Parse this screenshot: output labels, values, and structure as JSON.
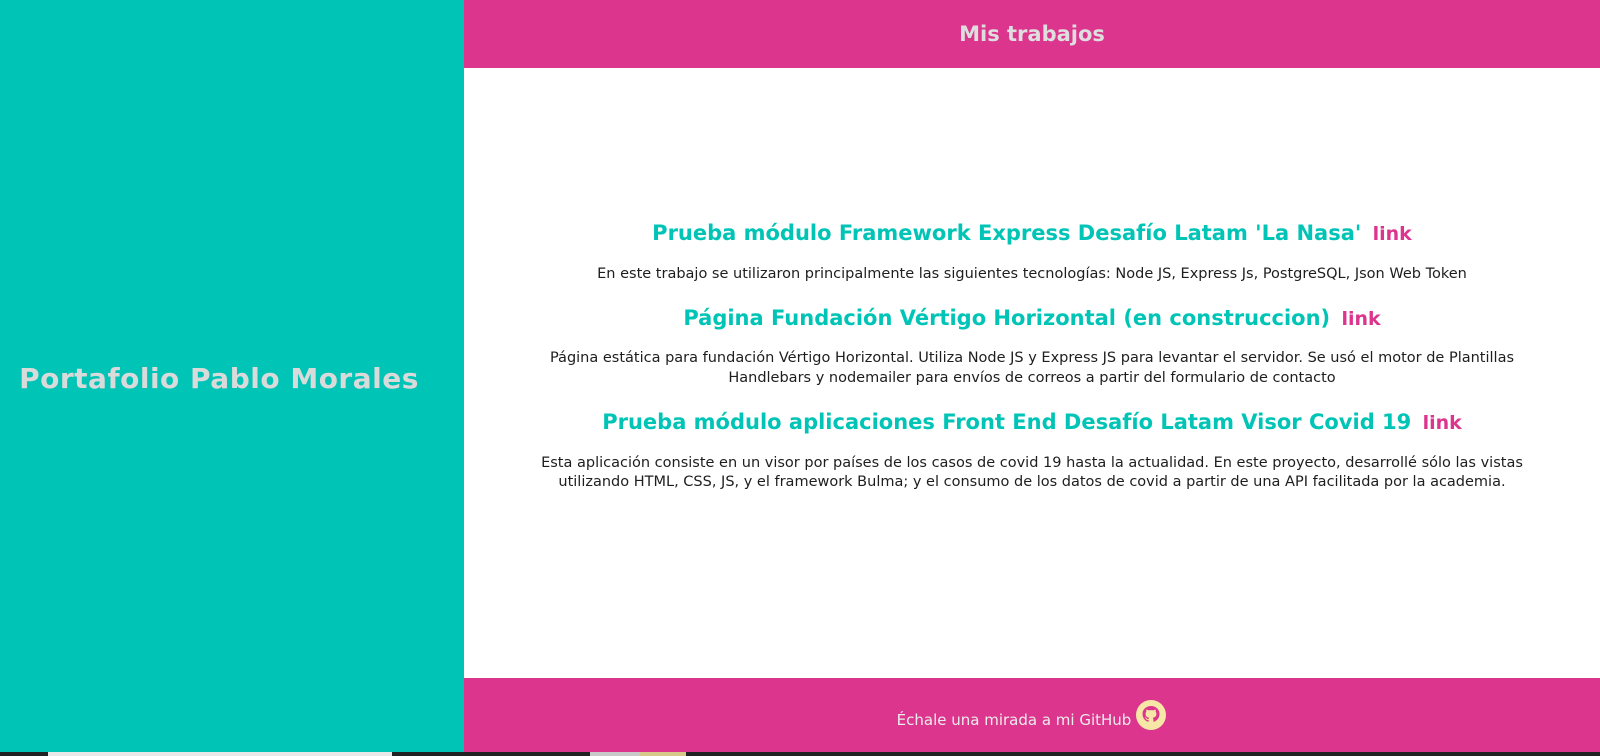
{
  "sidebar": {
    "title": "Portafolio Pablo Morales"
  },
  "header": {
    "title": "Mis trabajos"
  },
  "projects": [
    {
      "title": "Prueba módulo Framework Express Desafío Latam 'La Nasa'",
      "link_label": "link",
      "description": "En este trabajo se utilizaron principalmente las siguientes tecnologías: Node JS, Express Js, PostgreSQL, Json Web Token"
    },
    {
      "title": "Página Fundación Vértigo Horizontal (en construccion)",
      "link_label": "link",
      "description": "Página estática para fundación Vértigo Horizontal. Utiliza Node JS y Express JS para levantar el servidor. Se usó el motor de Plantillas Handlebars y nodemailer para envíos de correos a partir del formulario de contacto"
    },
    {
      "title": "Prueba módulo aplicaciones Front End Desafío Latam Visor Covid 19",
      "link_label": "link",
      "description": "Esta aplicación consiste en un visor por países de los casos de covid 19 hasta la actualidad. En este proyecto, desarrollé sólo las vistas utilizando HTML, CSS, JS, y el framework Bulma; y el consumo de los datos de covid a partir de una API facilitada por la academia."
    }
  ],
  "footer": {
    "text": "Échale una mirada a mi GitHub",
    "icon": "github-icon"
  },
  "colors": {
    "teal": "#00c4b6",
    "pink": "#dc358d",
    "icon_yellow": "#f6e7a6"
  }
}
